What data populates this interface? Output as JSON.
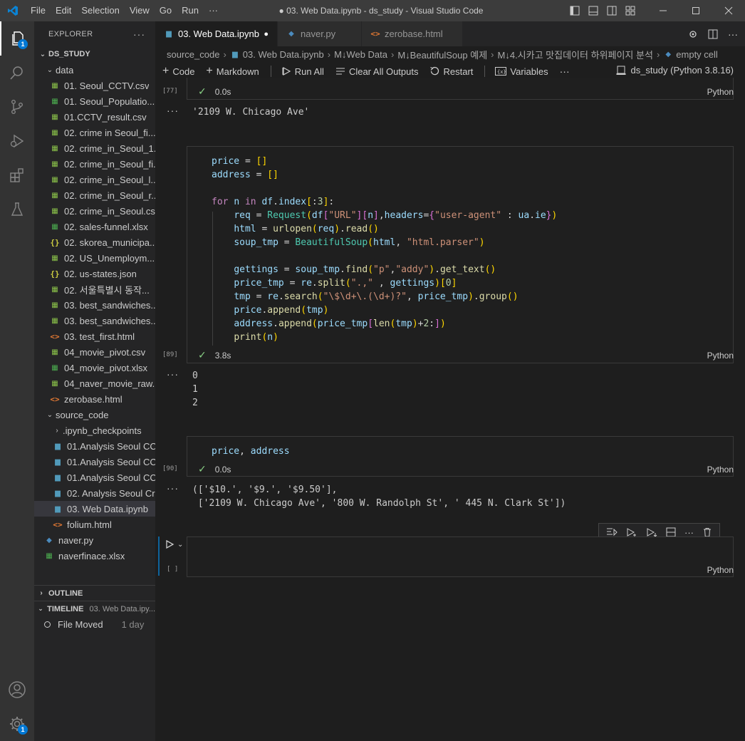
{
  "titlebar": {
    "menu": [
      "File",
      "Edit",
      "Selection",
      "View",
      "Go",
      "Run",
      "···"
    ],
    "title": "● 03. Web Data.ipynb - ds_study - Visual Studio Code"
  },
  "activity": {
    "explorer_badge": "1",
    "settings_badge": "1"
  },
  "sidebar": {
    "header": "EXPLORER",
    "root": "DS_STUDY",
    "data_folder": "data",
    "data_files": [
      {
        "name": "01. Seoul_CCTV.csv",
        "type": "csv"
      },
      {
        "name": "01. Seoul_Populatio...",
        "type": "xl"
      },
      {
        "name": "01.CCTV_result.csv",
        "type": "csv"
      },
      {
        "name": "02. crime in Seoul_fi...",
        "type": "csv"
      },
      {
        "name": "02. crime_in_Seoul_1...",
        "type": "csv"
      },
      {
        "name": "02. crime_in_Seoul_fi...",
        "type": "csv"
      },
      {
        "name": "02. crime_in_Seoul_l...",
        "type": "csv"
      },
      {
        "name": "02. crime_in_Seoul_r...",
        "type": "csv"
      },
      {
        "name": "02. crime_in_Seoul.csv",
        "type": "csv"
      },
      {
        "name": "02. sales-funnel.xlsx",
        "type": "xl"
      },
      {
        "name": "02. skorea_municipa...",
        "type": "json"
      },
      {
        "name": "02. US_Unemploym...",
        "type": "csv"
      },
      {
        "name": "02. us-states.json",
        "type": "json"
      },
      {
        "name": "02. 서울특별시 동작...",
        "type": "csv"
      },
      {
        "name": "03. best_sandwiches...",
        "type": "csv"
      },
      {
        "name": "03. best_sandwiches...",
        "type": "csv"
      },
      {
        "name": "03. test_first.html",
        "type": "html"
      },
      {
        "name": "04_movie_pivot.csv",
        "type": "csv"
      },
      {
        "name": "04_movie_pivot.xlsx",
        "type": "xl"
      },
      {
        "name": "04_naver_movie_raw...",
        "type": "csv"
      },
      {
        "name": "zerobase.html",
        "type": "html"
      }
    ],
    "source_folder": "source_code",
    "source_files": [
      {
        "name": ".ipynb_checkpoints",
        "type": "folder"
      },
      {
        "name": "01.Analysis Seoul CC...",
        "type": "nb"
      },
      {
        "name": "01.Analysis Seoul CC...",
        "type": "nb"
      },
      {
        "name": "01.Analysis Seoul CC...",
        "type": "nb"
      },
      {
        "name": "02. Analysis Seoul Cr...",
        "type": "nb"
      },
      {
        "name": "03. Web Data.ipynb",
        "type": "nb"
      },
      {
        "name": "folium.html",
        "type": "html"
      }
    ],
    "root_files": [
      {
        "name": "naver.py",
        "type": "py"
      },
      {
        "name": "naverfinace.xlsx",
        "type": "xl"
      }
    ],
    "outline": "OUTLINE",
    "timeline": "TIMELINE",
    "timeline_file": "03. Web Data.ipy...",
    "timeline_item": "File Moved",
    "timeline_time": "1 day"
  },
  "tabs": [
    {
      "label": "03. Web Data.ipynb",
      "dirty": "●"
    },
    {
      "label": "naver.py"
    },
    {
      "label": "zerobase.html"
    }
  ],
  "breadcrumb": [
    "source_code",
    "03. Web Data.ipynb",
    "M↓Web Data",
    "M↓BeautifulSoup 예제",
    "M↓4.시카고 맛집데이터 하위페이지 분석",
    "empty cell"
  ],
  "nbtoolbar": {
    "code": "Code",
    "markdown": "Markdown",
    "run_all": "Run All",
    "clear": "Clear All Outputs",
    "restart": "Restart",
    "variables": "Variables",
    "more": "···",
    "kernel": "ds_study (Python 3.8.16)"
  },
  "cells": {
    "c77": {
      "count": "[77]",
      "time": "0.0s",
      "lang": "Python",
      "output": "'2109 W. Chicago Ave'"
    },
    "c89": {
      "count": "[89]",
      "time": "3.8s",
      "lang": "Python",
      "output": "0\n1\n2"
    },
    "c90": {
      "count": "[90]",
      "time": "0.0s",
      "lang": "Python",
      "code": "price, address",
      "output": "(['$10.', '$9.', '$9.50'],\n ['2109 W. Chicago Ave', '800 W. Randolph St', ' 445 N. Clark St'])"
    },
    "empty": {
      "count": "[ ]",
      "lang": "Python"
    }
  },
  "ellipsis": "···"
}
